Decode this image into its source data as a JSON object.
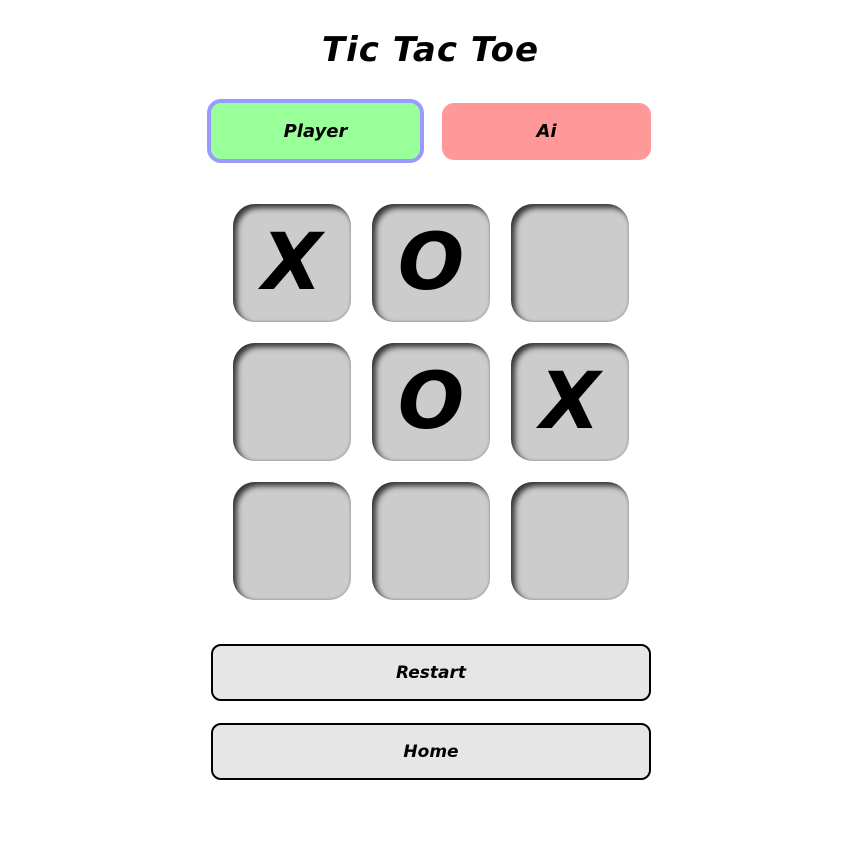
{
  "title": "Tic Tac Toe",
  "turn": {
    "player_label": "Player",
    "ai_label": "Ai",
    "active": "player",
    "player_color": "#99ff99",
    "ai_color": "#ff9999",
    "active_border_color": "#9999ff"
  },
  "board": {
    "cells": [
      "X",
      "O",
      "",
      "",
      "O",
      "X",
      "",
      "",
      ""
    ]
  },
  "actions": {
    "restart_label": "Restart",
    "home_label": "Home"
  }
}
